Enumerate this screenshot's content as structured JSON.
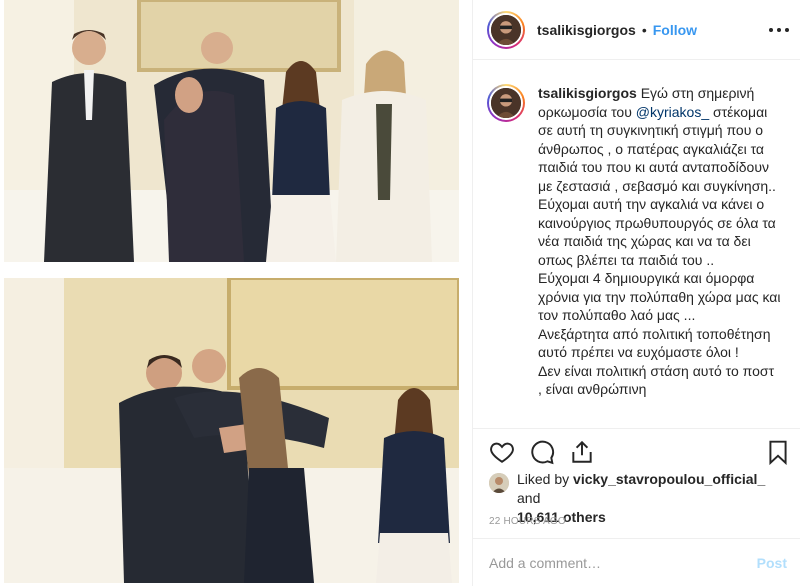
{
  "post": {
    "author": {
      "username": "tsalikisgiorgos",
      "separator": "•",
      "follow_label": "Follow",
      "avatar_icon": "profile-avatar"
    },
    "more_icon": "more-options-icon",
    "caption": {
      "username": "tsalikisgiorgos",
      "text_before_mention": " Εγώ στη σημερινή ορκωμοσία του ",
      "mention": "@kyriakos_",
      "text_after_mention": " στέκομαι σε αυτή τη συγκινητική στιγμή που ο άνθρωπος , ο πατέρας αγκαλιάζει τα παιδιά του που κι αυτά ανταποδίδουν με ζεστασιά , σεβασμό και συγκίνηση..\nΕύχομαι αυτή την αγκαλιά να κάνει ο καινούργιος πρωθυπουργός σε όλα τα νέα παιδιά της χώρας και να τα δει οπως βλέπει τα παιδιά του ..\nΕύχομαι 4 δημιουργικά και όμορφα χρόνια για την πολύπαθη χώρα μας και τον πολύπαθο λαό μας ...\nΑνεξάρτητα από πολιτική τοποθέτηση αυτό πρέπει να ευχόμαστε όλοι !\nΔεν είναι πολιτική στάση αυτό το ποστ , είναι ανθρώπινη"
    },
    "actions": {
      "like_icon": "heart-icon",
      "comment_icon": "comment-icon",
      "share_icon": "share-icon",
      "save_icon": "bookmark-icon"
    },
    "likes": {
      "prefix": "Liked by ",
      "first_liker": "vicky_stavropoulou_official_",
      "joiner": " and",
      "count": "10,611 others"
    },
    "timestamp": "22 HOURS AGO",
    "comment_box": {
      "placeholder": "Add a comment…",
      "post_label": "Post"
    }
  },
  "colors": {
    "link_blue": "#3897f0",
    "post_disabled": "#b2dffc",
    "mention": "#003569",
    "muted": "#999999",
    "divider": "#efefef"
  }
}
